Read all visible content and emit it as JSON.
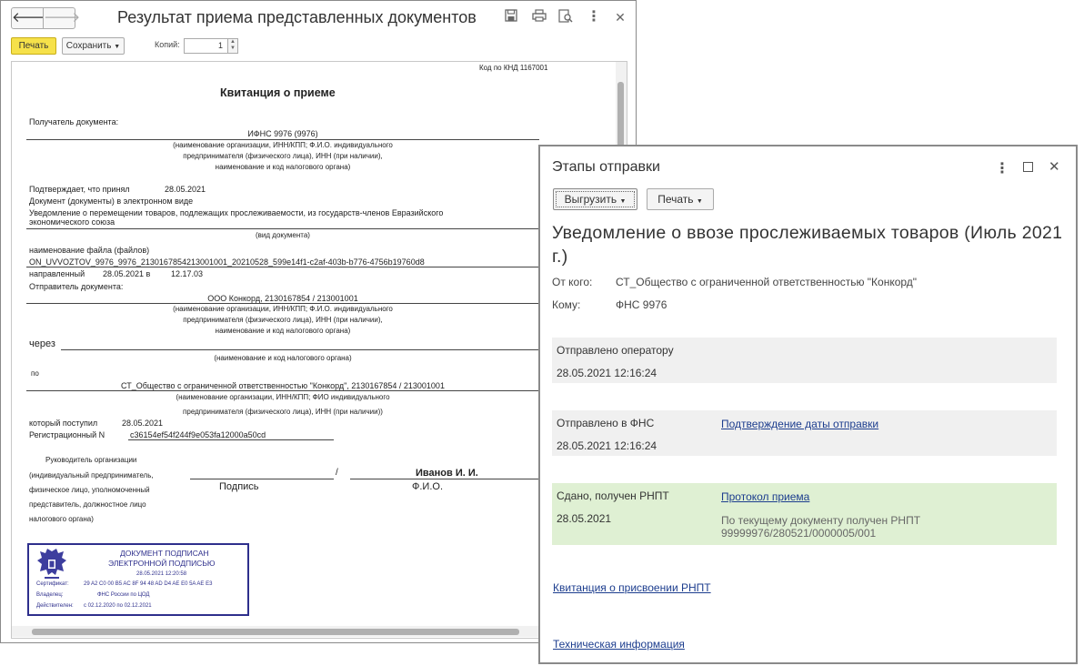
{
  "window1": {
    "title": "Результат приема представленных документов",
    "nav": {
      "back": "🡐",
      "forward": "🡒"
    },
    "toolbar": {
      "print_label": "Печать",
      "save_label": "Сохранить",
      "copies_label": "Копий:",
      "copies_value": "1"
    },
    "document": {
      "knd_code": "Код по КНД 1167001",
      "heading": "Квитанция о приеме",
      "recipient_label": "Получатель документа:",
      "recipient_value": "ИФНС 9976 (9976)",
      "recipient_note_1": "(наименование организации, ИНН/КПП; Ф.И.О. индивидуального",
      "recipient_note_2": "предпринимателя (физического лица), ИНН (при наличии),",
      "recipient_note_3": "наименование и код налогового органа)",
      "confirm_label": "Подтверждает, что принял",
      "confirm_date": "28.05.2021",
      "doc_label": "Документ (документы) в электронном виде",
      "doc_value_1": "Уведомление о перемещении товаров, подлежащих прослеживаемости, из государств-членов Евразийского",
      "doc_value_2": "экономического союза",
      "doc_kind_note": "(вид документа)",
      "file_label": "наименование файла (файлов)",
      "file_value": "ON_UVVOZTOV_9976_9976_2130167854213001001_20210528_599e14f1-c2af-403b-b776-4756b19760d8",
      "sent_label": "направленный",
      "sent_date": "28.05.2021 в",
      "sent_time": "12.17.03",
      "sender_label": "Отправитель документа:",
      "sender_value": "ООО Конкорд, 2130167854 / 213001001",
      "sender_note_1": "(наименование организации, ИНН/КПП; Ф.И.О. индивидуального",
      "sender_note_2": "предпринимателя (физического лица), ИНН (при наличии),",
      "sender_note_3": "наименование и код налогового органа)",
      "via_label": "через",
      "via_note": "(наименование и код налогового органа)",
      "po_label": "по",
      "po_value": "СТ_Общество с ограниченной ответственностью \"Конкорд\", 2130167854 / 213001001",
      "po_note_1": "(наименование организации, ИНН/КПП; ФИО индивидуального",
      "po_note_2": "предпринимателя (физического лица), ИНН (при наличии))",
      "received_label": "который поступил",
      "received_date": "28.05.2021",
      "reg_label": "Регистрационный N",
      "reg_value": "c36154ef54f244f9e053fa12000a50cd",
      "head_1": "Руководитель      организации",
      "head_2": "(индивидуальный предприниматель,",
      "head_3": "физическое лицо,  уполномоченный",
      "head_4": "представитель,  должностное лицо",
      "head_5": "налогового органа)",
      "slash": "/",
      "signer_name": "Иванов И. И.",
      "sign_label": "Подпись",
      "fio_label": "Ф.И.О.",
      "stamp": {
        "line1": "ДОКУМЕНТ ПОДПИСАН",
        "line2": "ЭЛЕКТРОННОЙ ПОДПИСЬЮ",
        "datetime": "28.05.2021 12:20:58",
        "cert_label": "Сертификат:",
        "cert_value": "29 A2 C0 00 B5 AC 8F 94 48 AD D4 AE E0 5A AE E3",
        "owner_label": "Владелец:",
        "owner_value": "ФНС России по ЦОД",
        "valid_label": "Действителен:",
        "valid_value": "с 02.12.2020 по 02.12.2021"
      }
    }
  },
  "window2": {
    "title": "Этапы отправки",
    "export_label": "Выгрузить",
    "print_label": "Печать",
    "doc_title": "Уведомление о ввозе прослеживаемых товаров (Июль 2021 г.)",
    "from_label": "От кого:",
    "from_value": "СТ_Общество с ограниченной ответственностью \"Конкорд\"",
    "to_label": "Кому:",
    "to_value": "ФНС 9976",
    "stages": [
      {
        "status": "Отправлено оператору",
        "datetime": "28.05.2021 12:16:24"
      },
      {
        "status": "Отправлено в ФНС",
        "datetime": "28.05.2021 12:16:24",
        "link": "Подтверждение даты отправки"
      },
      {
        "status": "Сдано, получен РНПТ",
        "datetime": "28.05.2021",
        "link": "Протокол приема",
        "note_1": "По текущему документу получен РНПТ",
        "note_2": "99999976/280521/0000005/001"
      }
    ],
    "rnpt_link": "Квитанция о присвоении РНПТ",
    "tech_link": "Техническая информация"
  }
}
